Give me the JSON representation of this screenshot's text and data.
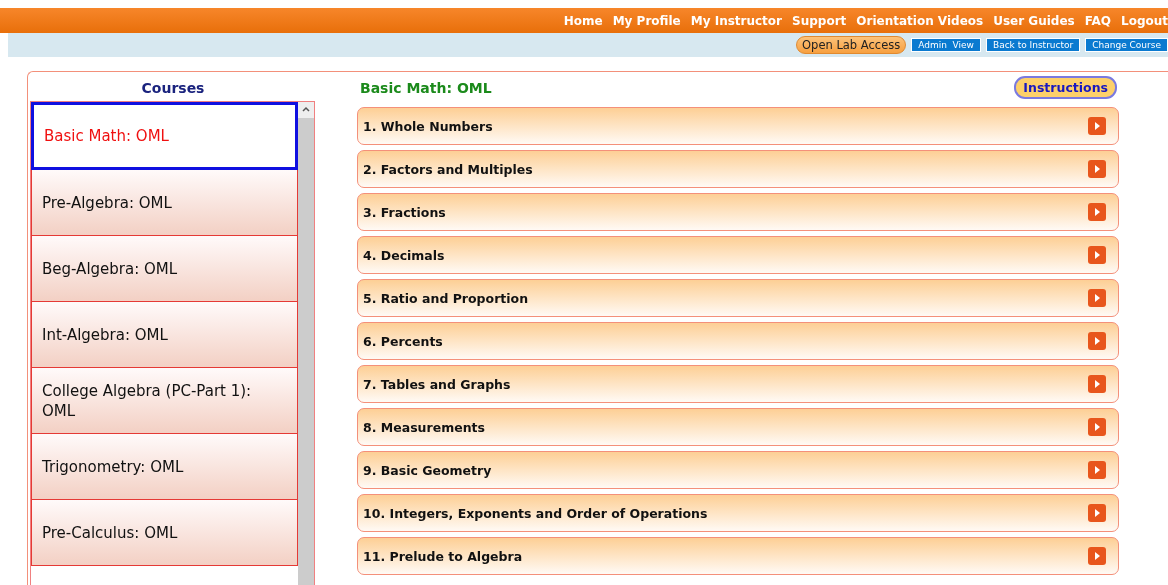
{
  "nav": [
    "Home",
    "My Profile",
    "My Instructor",
    "Support",
    "Orientation Videos",
    "User Guides",
    "FAQ",
    "Logout"
  ],
  "sub_buttons": [
    {
      "label": "Open Lab Access",
      "kind": "pill"
    },
    {
      "label": "Admin  View",
      "kind": "flat"
    },
    {
      "label": "Back to Instructor",
      "kind": "flat"
    },
    {
      "label": "Change Course",
      "kind": "flat"
    }
  ],
  "courses": {
    "title": "Courses",
    "items": [
      {
        "label": "Basic Math: OML",
        "selected": true
      },
      {
        "label": "Pre-Algebra: OML",
        "selected": false
      },
      {
        "label": "Beg-Algebra: OML",
        "selected": false
      },
      {
        "label": "Int-Algebra: OML",
        "selected": false
      },
      {
        "label": "College Algebra (PC-Part 1): OML",
        "selected": false
      },
      {
        "label": "Trigonometry: OML",
        "selected": false
      },
      {
        "label": "Pre-Calculus: OML",
        "selected": false
      }
    ]
  },
  "content": {
    "title": "Basic Math: OML",
    "instructions": "Instructions",
    "modules": [
      "1. Whole Numbers",
      "2. Factors and Multiples",
      "3. Fractions",
      "4. Decimals",
      "5. Ratio and Proportion",
      "6. Percents",
      "7. Tables and Graphs",
      "8. Measurements",
      "9. Basic Geometry",
      "10. Integers, Exponents and Order of Operations",
      "11. Prelude to Algebra"
    ]
  }
}
